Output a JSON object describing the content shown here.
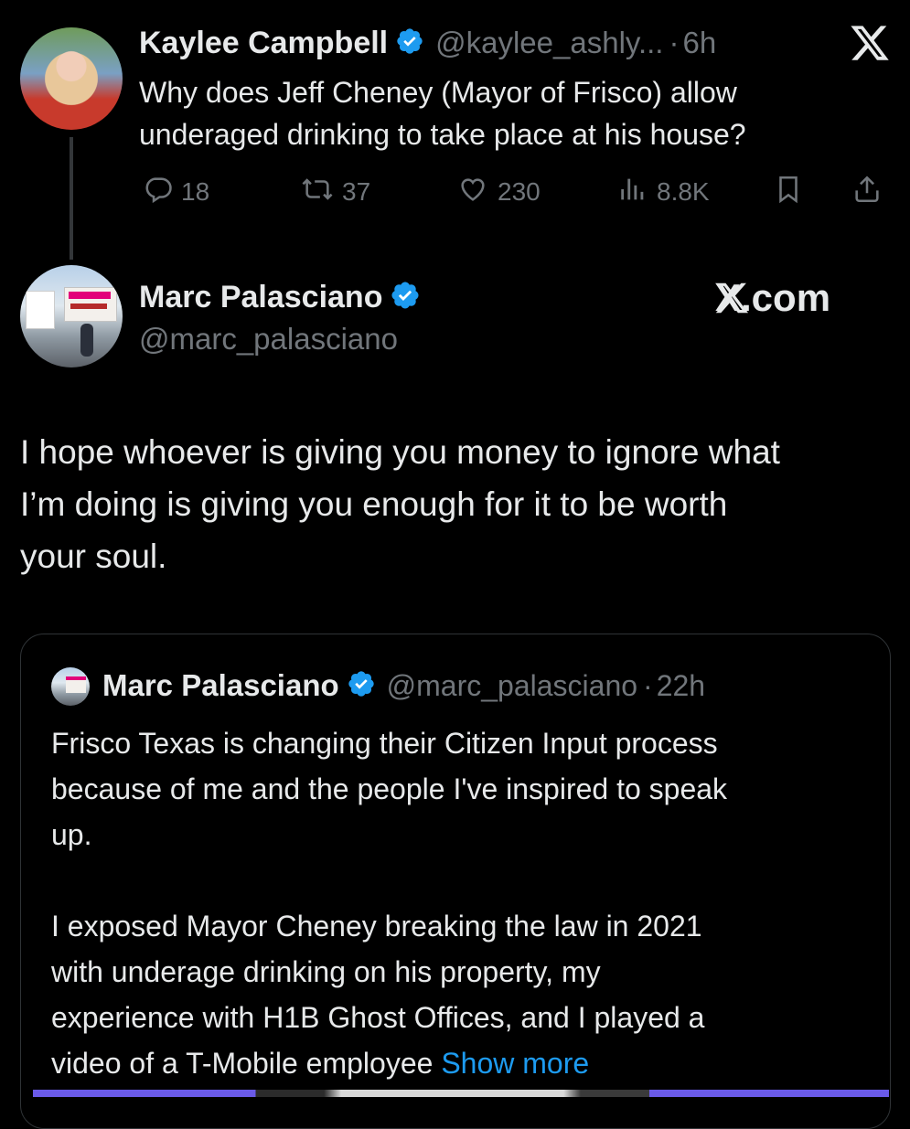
{
  "tweet1": {
    "name": "Kaylee Campbell",
    "handle": "@kaylee_ashly...",
    "sep": "·",
    "time": "6h",
    "text_line1": "Why does Jeff Cheney (Mayor of Frisco) allow",
    "text_line2": "underaged drinking to take place at his house?",
    "replies": "18",
    "reposts": "37",
    "likes": "230",
    "views": "8.8K"
  },
  "tweet2": {
    "name": "Marc Palasciano",
    "handle": "@marc_palasciano",
    "watermark": "X.com",
    "text_line1": "I hope whoever is giving you money to ignore what",
    "text_line2": "I’m doing is giving you enough for it to be worth",
    "text_line3": "your soul."
  },
  "quote": {
    "name": "Marc Palasciano",
    "handle": "@marc_palasciano",
    "sep": "·",
    "time": "22h",
    "line1": "Frisco Texas is changing their Citizen Input process",
    "line2": "because of me and the people I've inspired to speak",
    "line3": "up.",
    "line4": "I exposed Mayor Cheney breaking the law in 2021",
    "line5": "with underage drinking on his property, my",
    "line6": "experience with H1B Ghost Offices, and I played a",
    "line7": "video of a T-Mobile employee",
    "show_more": "Show more"
  },
  "colors": {
    "background": "#000000",
    "text": "#e7e9ea",
    "muted": "#71767b",
    "verified": "#1d9bf0",
    "link": "#1d9bf0",
    "border": "#2f3336"
  },
  "icons": [
    "x-logo-icon",
    "verified-badge-icon",
    "reply-icon",
    "repost-icon",
    "like-icon",
    "views-icon",
    "bookmark-icon",
    "share-icon"
  ]
}
